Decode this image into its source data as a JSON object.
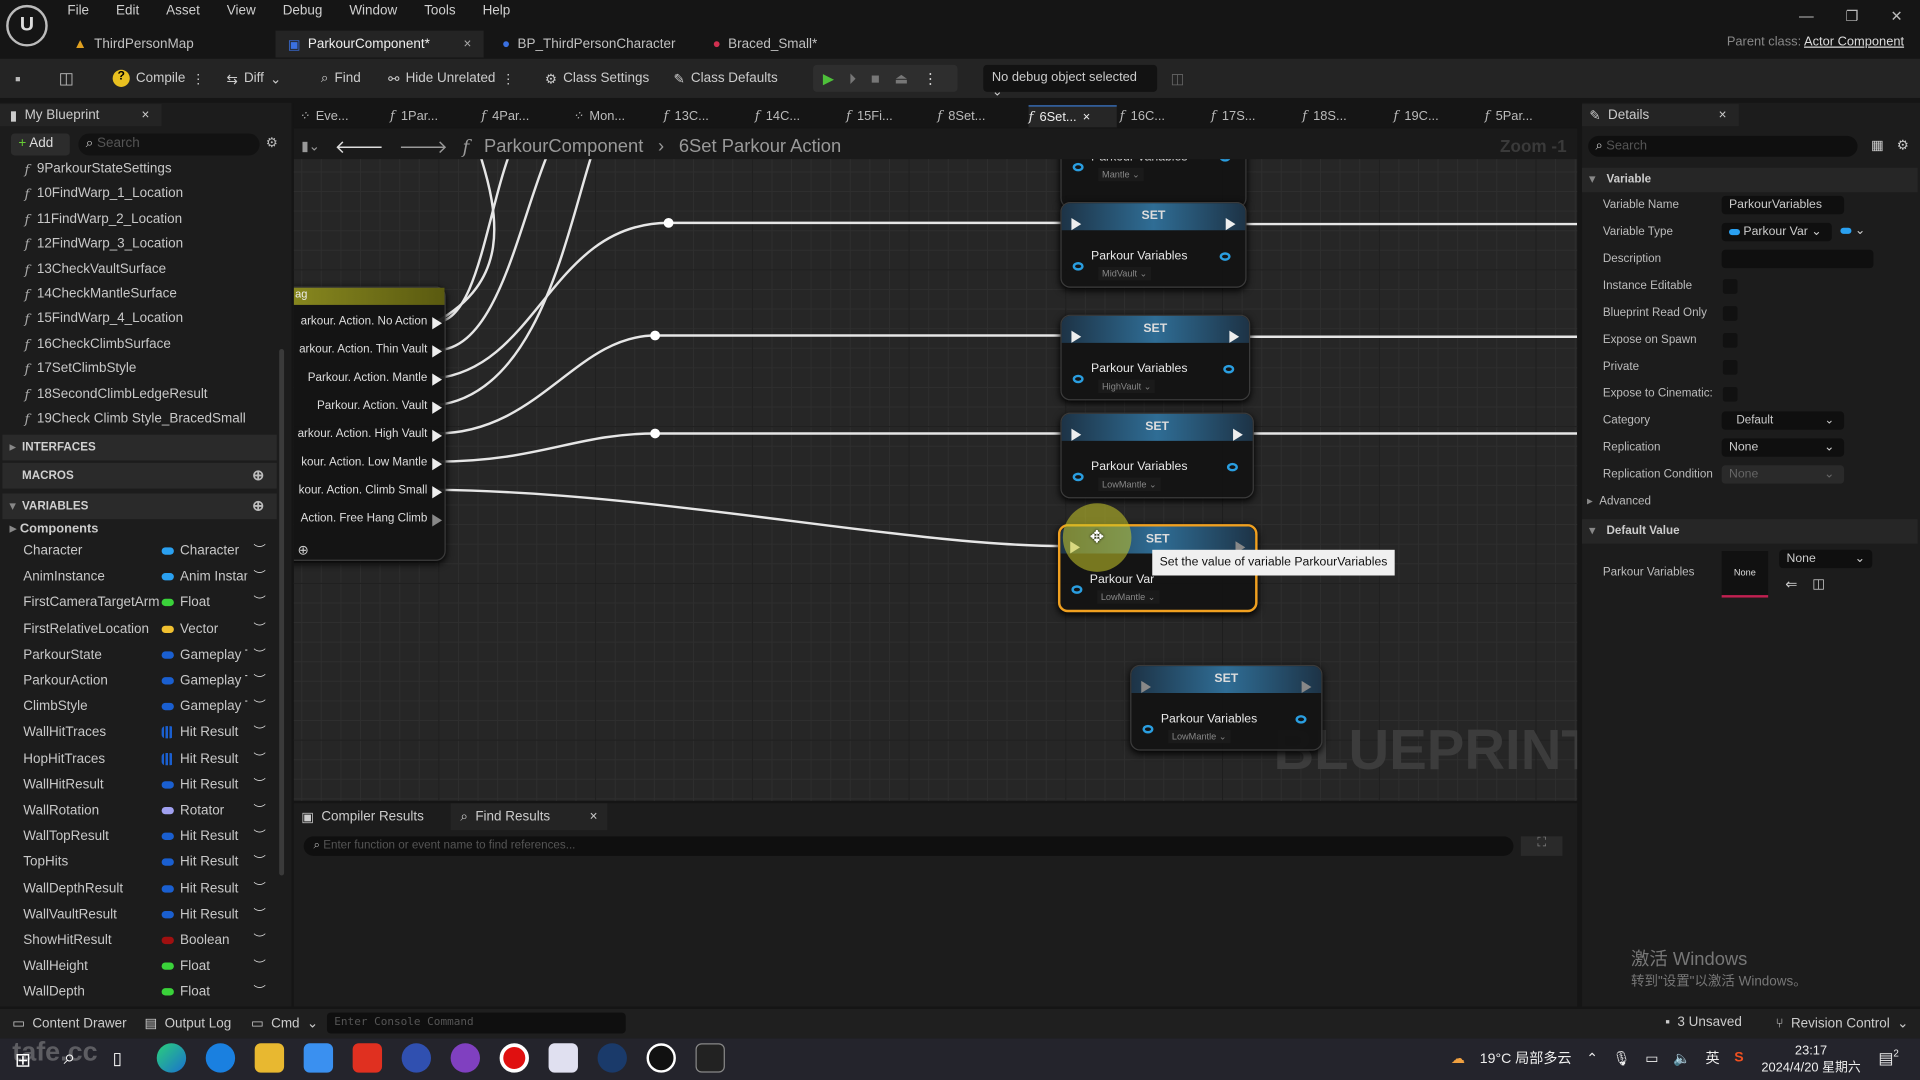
{
  "menu": [
    "File",
    "Edit",
    "Asset",
    "View",
    "Debug",
    "Window",
    "Tools",
    "Help"
  ],
  "asset_tabs": [
    {
      "label": "ThirdPersonMap",
      "icon": "level-icon"
    },
    {
      "label": "ParkourComponent*",
      "icon": "blueprint-icon",
      "active": true
    },
    {
      "label": "BP_ThirdPersonCharacter",
      "icon": "character-icon"
    },
    {
      "label": "Braced_Small*",
      "icon": "animation-icon"
    }
  ],
  "parent_class": {
    "label": "Parent class:",
    "value": "Actor Component"
  },
  "toolbar": {
    "compile": "Compile",
    "diff": "Diff",
    "find": "Find",
    "hide_unrelated": "Hide Unrelated",
    "class_settings": "Class Settings",
    "class_defaults": "Class Defaults",
    "debug_object": "No debug object selected"
  },
  "my_blueprint": {
    "title": "My Blueprint",
    "add": "Add",
    "search_placeholder": "Search",
    "functions": [
      "9ParkourStateSettings",
      "10FindWarp_1_Location",
      "11FindWarp_2_Location",
      "12FindWarp_3_Location",
      "13CheckVaultSurface",
      "14CheckMantleSurface",
      "15FindWarp_4_Location",
      "16CheckClimbSurface",
      "17SetClimbStyle",
      "18SecondClimbLedgeResult",
      "19Check Climb Style_BracedSmall"
    ],
    "sections": {
      "interfaces": "INTERFACES",
      "macros": "MACROS",
      "variables": "VARIABLES",
      "components": "Components"
    },
    "variables": [
      {
        "name": "Character",
        "type": "Character",
        "color": "#2aa0f0"
      },
      {
        "name": "AnimInstance",
        "type": "Anim Instance",
        "color": "#2aa0f0"
      },
      {
        "name": "FirstCameraTargetArm",
        "type": "Float",
        "color": "#3ad23a"
      },
      {
        "name": "FirstRelativeLocation",
        "type": "Vector",
        "color": "#f0c030"
      },
      {
        "name": "ParkourState",
        "type": "Gameplay Tag",
        "color": "#1a5fd0"
      },
      {
        "name": "ParkourAction",
        "type": "Gameplay Tag",
        "color": "#1a5fd0"
      },
      {
        "name": "ClimbStyle",
        "type": "Gameplay Tag",
        "color": "#1a5fd0"
      },
      {
        "name": "WallHitTraces",
        "type": "Hit Result",
        "color": "#1a5fd0",
        "array": true
      },
      {
        "name": "HopHitTraces",
        "type": "Hit Result",
        "color": "#1a5fd0",
        "array": true
      },
      {
        "name": "WallHitResult",
        "type": "Hit Result",
        "color": "#1a5fd0"
      },
      {
        "name": "WallRotation",
        "type": "Rotator",
        "color": "#a0a0f0"
      },
      {
        "name": "WallTopResult",
        "type": "Hit Result",
        "color": "#1a5fd0"
      },
      {
        "name": "TopHits",
        "type": "Hit Result",
        "color": "#1a5fd0"
      },
      {
        "name": "WallDepthResult",
        "type": "Hit Result",
        "color": "#1a5fd0"
      },
      {
        "name": "WallVaultResult",
        "type": "Hit Result",
        "color": "#1a5fd0"
      },
      {
        "name": "ShowHitResult",
        "type": "Boolean",
        "color": "#a01010"
      },
      {
        "name": "WallHeight",
        "type": "Float",
        "color": "#3ad23a"
      },
      {
        "name": "WallDepth",
        "type": "Float",
        "color": "#3ad23a"
      }
    ]
  },
  "graph_tabs": [
    {
      "label": "Eve...",
      "icon": "event-graph-icon"
    },
    {
      "label": "1Par...",
      "icon": "function-icon"
    },
    {
      "label": "4Par...",
      "icon": "function-icon"
    },
    {
      "label": "Mon...",
      "icon": "event-graph-icon"
    },
    {
      "label": "13C...",
      "icon": "function-icon"
    },
    {
      "label": "14C...",
      "icon": "function-icon"
    },
    {
      "label": "15Fi...",
      "icon": "function-icon"
    },
    {
      "label": "8Set...",
      "icon": "function-icon"
    },
    {
      "label": "6Set...",
      "icon": "function-icon",
      "active": true
    },
    {
      "label": "16C...",
      "icon": "function-icon"
    },
    {
      "label": "17S...",
      "icon": "function-icon"
    },
    {
      "label": "18S...",
      "icon": "function-icon"
    },
    {
      "label": "19C...",
      "icon": "function-icon"
    },
    {
      "label": "5Par...",
      "icon": "function-icon"
    }
  ],
  "breadcrumb": {
    "root": "ParkourComponent",
    "current": "6Set Parkour Action"
  },
  "zoom": "Zoom -1",
  "watermark": "BLUEPRINT",
  "switch_node": {
    "title": "ag",
    "outputs": [
      "arkour. Action. No Action",
      "arkour. Action. Thin Vault",
      "Parkour. Action. Mantle",
      "Parkour. Action. Vault",
      "arkour. Action. High Vault",
      "kour. Action. Low Mantle",
      "kour. Action. Climb Small",
      "Action. Free Hang Climb"
    ]
  },
  "set_nodes": [
    {
      "title": "",
      "label": "Parkour Variables",
      "value": "Mantle"
    },
    {
      "title": "SET",
      "label": "Parkour Variables",
      "value": "MidVault"
    },
    {
      "title": "SET",
      "label": "Parkour Variables",
      "value": "HighVault"
    },
    {
      "title": "SET",
      "label": "Parkour Variables",
      "value": "LowMantle"
    },
    {
      "title": "SET",
      "label": "Parkour Var",
      "value": "LowMantle"
    },
    {
      "title": "SET",
      "label": "Parkour Variables",
      "value": "LowMantle"
    }
  ],
  "tooltip": "Set the value of variable ParkourVariables",
  "bottom": {
    "tabs": [
      "Compiler Results",
      "Find Results"
    ],
    "find_placeholder": "Enter function or event name to find references..."
  },
  "details": {
    "title": "Details",
    "search_placeholder": "Search",
    "section_variable": "Variable",
    "rows": {
      "variable_name": {
        "label": "Variable Name",
        "value": "ParkourVariables"
      },
      "variable_type": {
        "label": "Variable Type",
        "value": "Parkour Var"
      },
      "description": {
        "label": "Description",
        "value": ""
      },
      "instance_editable": {
        "label": "Instance Editable"
      },
      "blueprint_read_only": {
        "label": "Blueprint Read Only"
      },
      "expose_on_spawn": {
        "label": "Expose on Spawn"
      },
      "private": {
        "label": "Private"
      },
      "expose_to_cinematics": {
        "label": "Expose to Cinematic:"
      },
      "category": {
        "label": "Category",
        "value": "Default"
      },
      "replication": {
        "label": "Replication",
        "value": "None"
      },
      "replication_condition": {
        "label": "Replication Condition",
        "value": "None"
      }
    },
    "advanced": "Advanced",
    "section_default": "Default Value",
    "default_label": "Parkour Variables",
    "default_thumb": "None",
    "default_select": "None"
  },
  "status": {
    "content_drawer": "Content Drawer",
    "output_log": "Output Log",
    "cmd": "Cmd",
    "console_placeholder": "Enter Console Command",
    "unsaved": "3 Unsaved",
    "revision": "Revision Control"
  },
  "activate_windows": {
    "line1": "激活 Windows",
    "line2": "转到\"设置\"以激活 Windows。"
  },
  "taskbar": {
    "weather": "19°C 局部多云",
    "ime": "英",
    "time": "23:17",
    "date": "2024/4/20 星期六",
    "notifications": "2",
    "watermark": "tafe.cc"
  }
}
